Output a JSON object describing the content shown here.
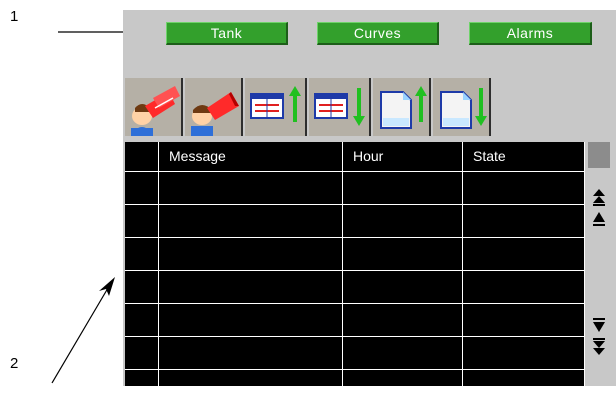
{
  "callouts": {
    "one": "1",
    "two": "2"
  },
  "nav": {
    "tank_label": "Tank",
    "curves_label": "Curves",
    "alarms_label": "Alarms"
  },
  "toolbar": {
    "icons": [
      "alarm-acknowledge-all-icon",
      "alarm-acknowledge-icon",
      "table-scroll-up-icon",
      "table-scroll-down-icon",
      "page-up-icon",
      "page-down-icon"
    ]
  },
  "alarm_table": {
    "columns": [
      "",
      "Message",
      "Hour",
      "State"
    ],
    "row_count": 7
  },
  "colors": {
    "panel": "#c8c8c8",
    "button_green": "#33a02c",
    "table_bg": "#000000",
    "grid_lines": "#ffffff"
  }
}
